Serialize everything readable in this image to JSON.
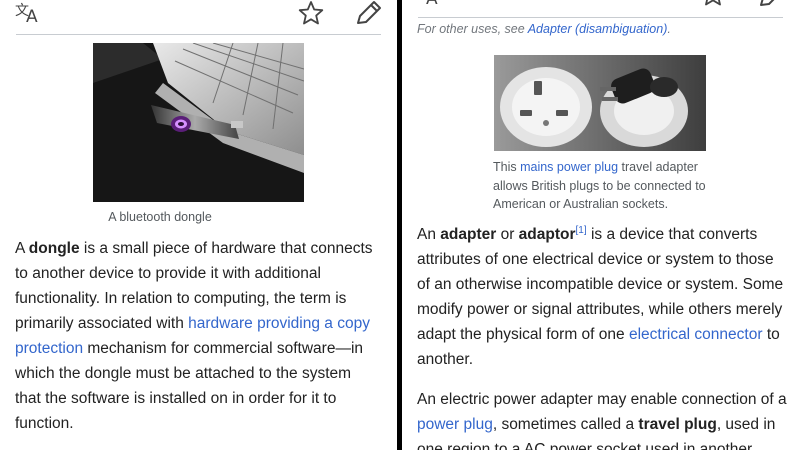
{
  "left_article": {
    "figure_caption": "A bluetooth dongle",
    "para": {
      "t1": "A ",
      "b1": "dongle",
      "t2": " is a small piece of hardware that connects to another device to provide it with additional functionality. In relation to computing, the term is primarily associated with ",
      "link1": "hardware providing a copy protection",
      "t3": " mechanism for commercial software—in which the dongle must be attached to the system that the software is installed on in order for it to function."
    }
  },
  "right_article": {
    "hatnote": {
      "prefix": "For other uses, see ",
      "link": "Adapter (disambiguation)",
      "suffix": "."
    },
    "caption": {
      "t1": "This ",
      "link": "mains power plug",
      "t2": " travel adapter allows British plugs to be connected to American or Australian sockets."
    },
    "para1": {
      "t1": "An ",
      "b1": "adapter",
      "t2": " or ",
      "b2": "adaptor",
      "ref": "[1]",
      "t3": " is a device that converts attributes of one electrical device or system to those of an otherwise incompatible device or system. Some modify power or signal attributes, while others merely adapt the physical form of one ",
      "link": "electrical connector",
      "t4": " to another."
    },
    "para2": {
      "t1": "An electric power adapter may enable connection of a ",
      "link": "power plug",
      "t2": ", sometimes called a ",
      "b1": "travel plug",
      "t3": ", used in one region to a AC power socket used in another"
    }
  },
  "icons": [
    "translate-icon",
    "star-icon",
    "edit-pencil-icon"
  ],
  "colors": {
    "link": "#3366cc",
    "text": "#222222",
    "caption": "#54595d",
    "divider": "#000000"
  }
}
